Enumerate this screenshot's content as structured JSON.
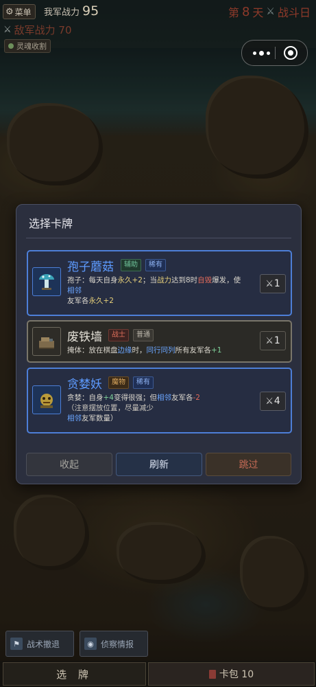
{
  "hud": {
    "menu_label": "菜单",
    "our_power_label": "我军战力",
    "our_power_value": "95",
    "day_prefix": "第",
    "day_number": "8",
    "day_suffix": "天",
    "battle_day_label": "战斗日",
    "enemy_power_label": "敌军战力 70",
    "collect_label": "灵魂收割"
  },
  "modal": {
    "title": "选择卡牌",
    "cards": [
      {
        "name": "孢子蘑菇",
        "type_tag": "辅助",
        "rarity_tag": "稀有",
        "icon": "mushroom-icon",
        "desc_parts": [
          "孢子：每天自身",
          "永久+2",
          "；当",
          "战力",
          "达到8时",
          "自毁",
          "爆发，使",
          "相邻",
          "友军各",
          "永久+2"
        ],
        "cost": "1"
      },
      {
        "name": "废铁墙",
        "type_tag": "战士",
        "rarity_tag": "普通",
        "icon": "scrap-wall-icon",
        "desc_parts": [
          "掩体：放在棋盘",
          "边缘",
          "时，",
          "同行同列",
          "所有友军各",
          "+1"
        ],
        "cost": "1"
      },
      {
        "name": "贪婪妖",
        "type_tag": "魔物",
        "rarity_tag": "稀有",
        "icon": "greed-demon-icon",
        "desc_parts": [
          "贪婪：自身",
          "+4",
          "变得很强；但",
          "相邻",
          "友军各",
          "-2",
          "（注意摆放位置，尽量减少",
          "相邻",
          "友军数量）"
        ],
        "cost": "4"
      }
    ],
    "buttons": {
      "fold": "收起",
      "refresh": "刷新",
      "skip": "跳过"
    }
  },
  "bottom": {
    "tactic_label": "战术撤退",
    "scout_label": "侦察情报",
    "draw_label": "选 牌",
    "pack_label": "卡包 10"
  },
  "mini_program": {
    "more_icon": "more-dots-icon",
    "close_icon": "target-close-icon"
  }
}
